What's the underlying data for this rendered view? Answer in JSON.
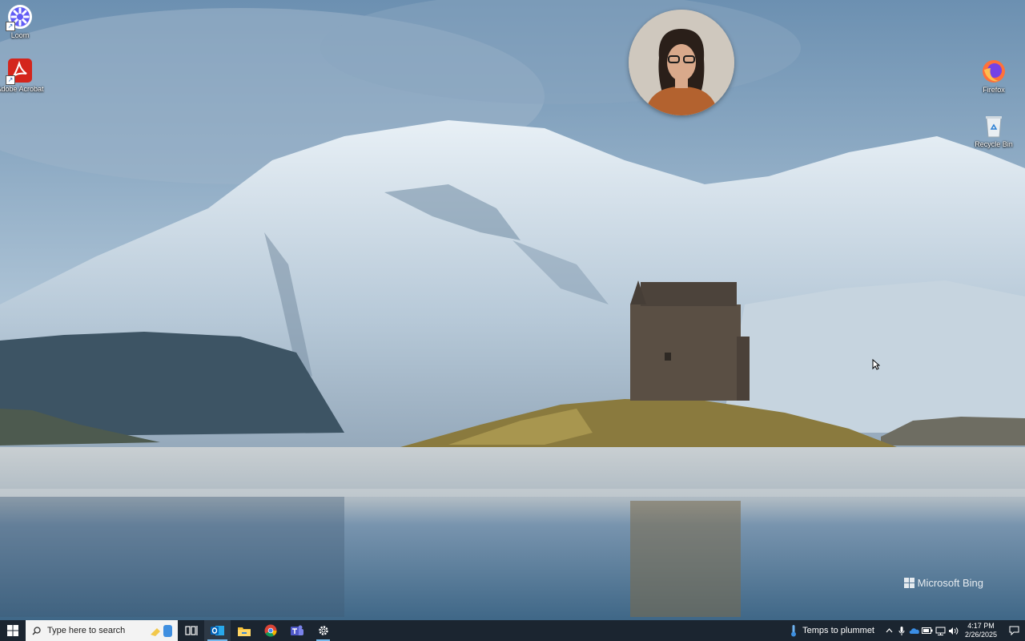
{
  "desktop": {
    "icons_left": [
      {
        "label": "Loom",
        "icon": "loom-icon"
      },
      {
        "label": "Adobe Acrobat",
        "icon": "adobe-acrobat-icon"
      }
    ],
    "icons_right": [
      {
        "label": "Firefox",
        "icon": "firefox-icon"
      },
      {
        "label": "Recycle Bin",
        "icon": "recycle-bin-icon"
      }
    ],
    "watermark": "Microsoft Bing"
  },
  "taskbar": {
    "search_placeholder": "Type here to search",
    "apps": [
      {
        "name": "Task View",
        "icon": "task-view-icon",
        "state": "none"
      },
      {
        "name": "Outlook",
        "icon": "outlook-icon",
        "state": "active"
      },
      {
        "name": "File Explorer",
        "icon": "file-explorer-icon",
        "state": "none"
      },
      {
        "name": "Chrome",
        "icon": "chrome-icon",
        "state": "none"
      },
      {
        "name": "Teams",
        "icon": "teams-icon",
        "state": "none"
      },
      {
        "name": "Settings",
        "icon": "settings-gear-icon",
        "state": "open"
      }
    ],
    "weather": "Temps to plummet",
    "time": "4:17 PM",
    "date": "2/26/2025"
  },
  "colors": {
    "taskbar_bg": "#1b2530",
    "accent": "#76b9ed"
  }
}
